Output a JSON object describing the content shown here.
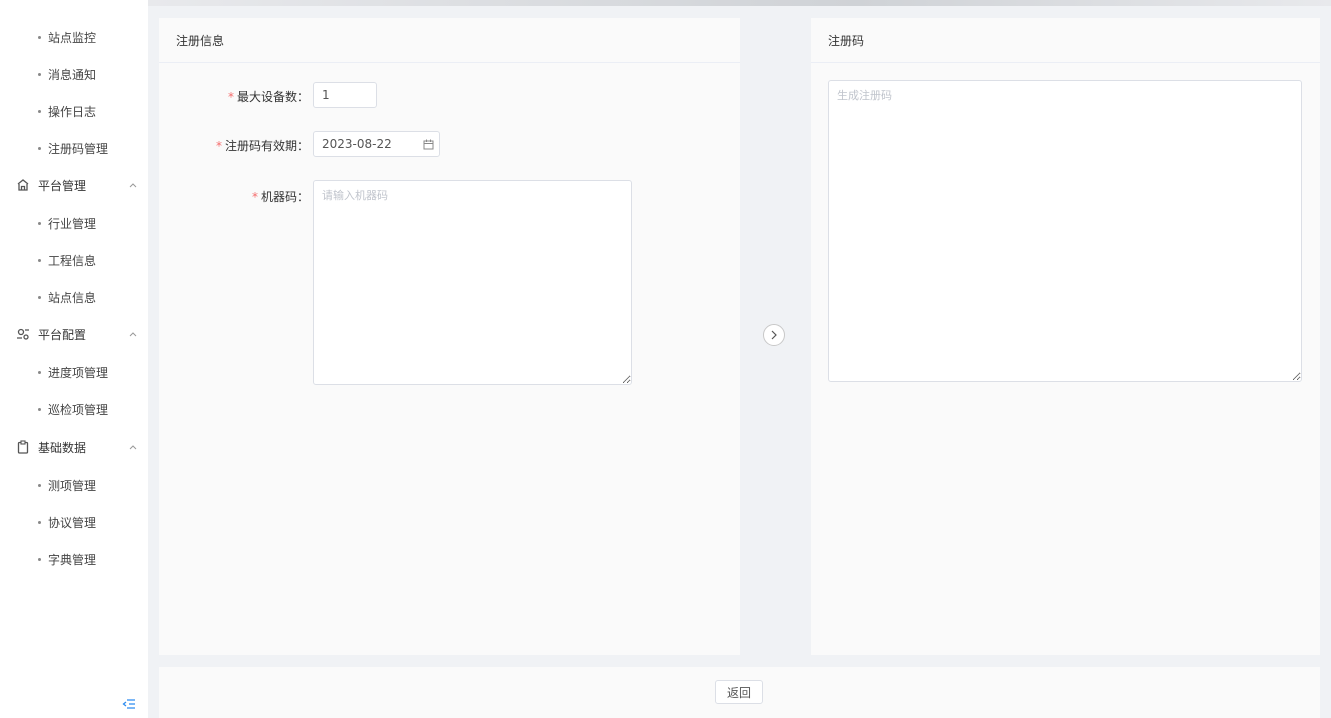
{
  "sidebar": {
    "groups": [
      {
        "label": "平台管理",
        "icon": "building-icon",
        "items": [
          "行业管理",
          "工程信息",
          "站点信息"
        ]
      },
      {
        "label": "平台配置",
        "icon": "settings-icon",
        "items": [
          "进度项管理",
          "巡检项管理"
        ]
      },
      {
        "label": "基础数据",
        "icon": "clipboard-icon",
        "items": [
          "测项管理",
          "协议管理",
          "字典管理"
        ]
      }
    ],
    "top_items": [
      "站点监控",
      "消息通知",
      "操作日志",
      "注册码管理"
    ]
  },
  "left_panel": {
    "title": "注册信息",
    "max_devices_label": "最大设备数",
    "max_devices_value": "1",
    "expiry_label": "注册码有效期",
    "expiry_value": "2023-08-22",
    "machine_code_label": "机器码",
    "machine_code_placeholder": "请输入机器码"
  },
  "right_panel": {
    "title": "注册码",
    "code_placeholder": "生成注册码"
  },
  "footer": {
    "back_label": "返回"
  }
}
